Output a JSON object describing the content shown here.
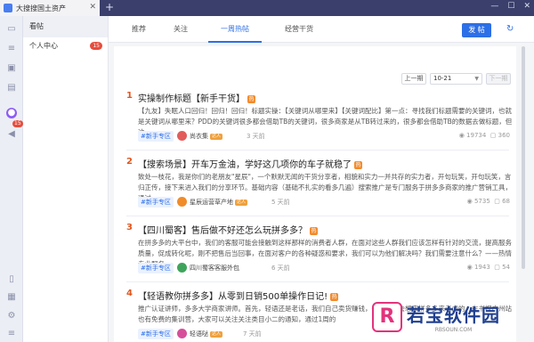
{
  "app": {
    "title": "大搜搜国土资产"
  },
  "sidebar_panel": {
    "header": "看帖",
    "items": [
      {
        "label": "个人中心",
        "count": "15"
      }
    ]
  },
  "rail": {
    "badge": "15"
  },
  "tabs": [
    "推荐",
    "关注",
    "一周热帖",
    "经营干货"
  ],
  "toolbar": {
    "post_label": "发 帖"
  },
  "pager": {
    "prev": "上一期",
    "date": "10-21",
    "next": "下一期"
  },
  "posts": [
    {
      "num": "1",
      "title": "实操制作标题【新手干货】",
      "body": "【九友】失眠人口回归！回归！回归！标题实操：【关键词从哪里来】【关键词配比】第一点：寻找我们标题需要的关键词，也就是关键词从哪里来？PDD的关键词很多都会借助TB的关键词，很多商家是从TB转过来的，很多都会借助TB的数据去做标题，但这一",
      "tag": "#新手专区",
      "author": "尚衣集",
      "level": "达人",
      "time": "3 天前",
      "views": "19734",
      "comments": "360",
      "avatar_color": "#e25c5c"
    },
    {
      "num": "2",
      "title": "【搜索场景】开车万金油，学好这几项你的车子就稳了",
      "body": "致处一枝花，我是你们的老朋友\"星辰\"，一个默默无闻的干货分享者，相貌和实力一并共存的实力者，开句玩笑，开句玩笑，言归正传，接下来进入我们的分享环节。基础内容（基础不扎实的看多几遍）搜索推广是专门服务于拼多多商家的推广营销工具，通过",
      "tag": "#新手专区",
      "author": "星辰运营草产地",
      "level": "达人",
      "time": "5 天前",
      "views": "5735",
      "comments": "68",
      "avatar_color": "#f08c2a"
    },
    {
      "num": "3",
      "title": "【四川蜀客】售后做不好还怎么玩拼多多？",
      "body": "在拼多多的大平台中，我们的客服可能会接触到这样那样的消费者人群，在面对这些人群我们应该怎样有针对的交流，提高服务质量，促成转化呢，刚不把售后当回事，在面对客户的各种疑惑和要求，我们可以为他们解决吗？我们需要注意什么？——热情专业服务…",
      "tag": "#新手专区",
      "author": "四川蜀客客服外包",
      "level": "",
      "time": "6 天前",
      "views": "1943",
      "comments": "54",
      "avatar_color": "#3fa45b"
    },
    {
      "num": "4",
      "title": "【轻语教你拼多多】从零到日销500单操作日记!",
      "body": "推广认证讲师，多多大学商家讲师。首先，轻语还是老话，我们自己卖货赚钱，一般是不会想来拼多多来考虑的。在书视广州站也有免费的集训营，大家可以关注关注类目小二的通知，通过1周的",
      "tag": "#新手专区",
      "author": "轻语哒",
      "level": "达人",
      "time": "7 天前",
      "views": "",
      "comments": "",
      "avatar_color": "#d64f9a"
    }
  ],
  "watermark": {
    "logo": "R",
    "title": "若宝软件园",
    "sub": "RBSOUN.COM"
  }
}
